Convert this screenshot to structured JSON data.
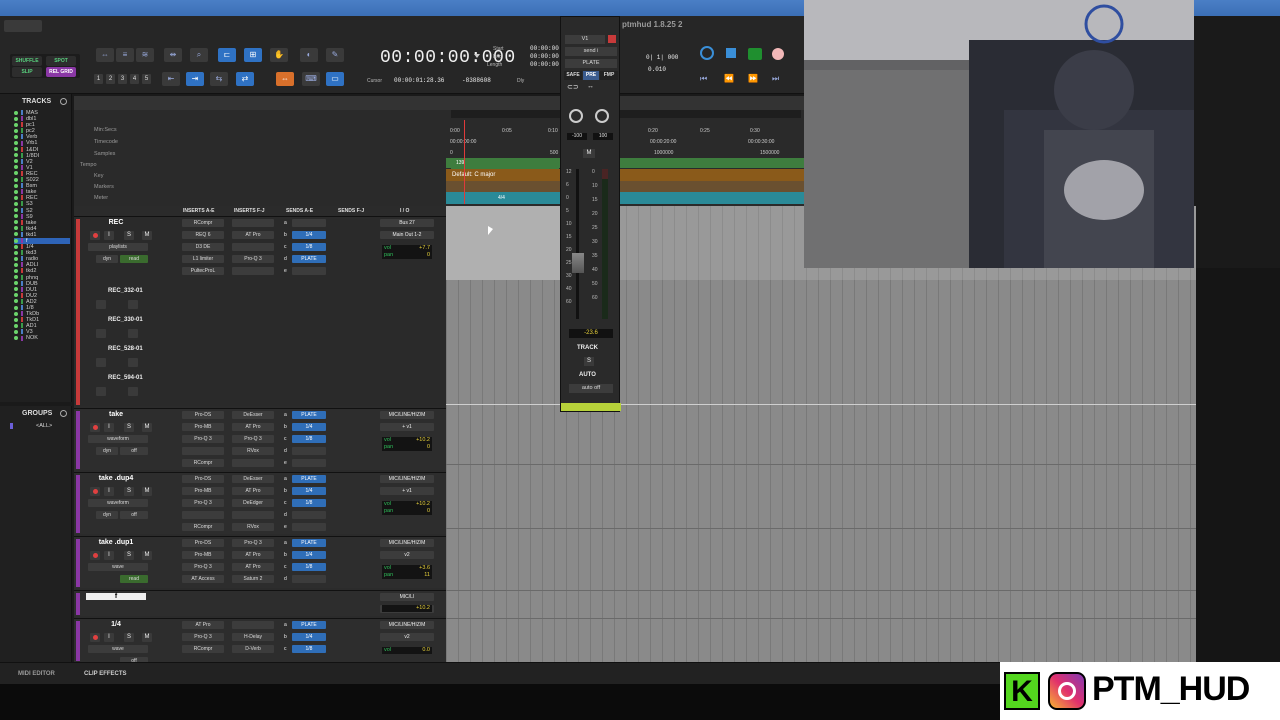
{
  "transport": {
    "modes": [
      "SHUFFLE",
      "SPOT",
      "SLIP",
      "REL GRID"
    ],
    "numbers": [
      "1",
      "2",
      "3",
      "4",
      "5"
    ],
    "main_counter": "00:00:00:000",
    "cursor_label": "Cursor",
    "cursor_value": "00:00:01:28.36",
    "cursor_sample": "-8388608",
    "dly_label": "Dly",
    "start_label": "Start",
    "end_label": "End",
    "length_label": "Length",
    "start_value": "00:00:00",
    "end_value": "00:00:00",
    "length_value": "00:00:00",
    "grid_value": "0| 1| 000",
    "nudge_value": "0.010"
  },
  "window_title": "ptmhud 1.8.25 2",
  "tracks_panel": {
    "title": "TRACKS",
    "items": [
      "MAS",
      "dbl1",
      "pc1",
      "pc2",
      "Verb",
      "Vrb1",
      "1&DI",
      "1/8DI",
      "V2",
      "V1",
      "REC",
      "S022",
      "Bsm",
      "take",
      "REC",
      "S3",
      "S2",
      "S9",
      "take",
      "tkd4",
      "tkd1",
      "f",
      "1/4",
      "tkd3",
      "radio",
      "ADLI",
      "tkd2",
      "phnq",
      "DUB",
      "DU1",
      "DU2",
      "AD2",
      "1/8",
      "TkDb",
      "TkD1",
      "AD1",
      "V3",
      "NOK"
    ]
  },
  "groups_panel": {
    "title": "GROUPS",
    "item": "<ALL>"
  },
  "rulers": {
    "names": [
      "Min:Secs",
      "Timecode",
      "Samples",
      "Tempo",
      "Key",
      "Markers",
      "Meter"
    ],
    "minsecs": [
      "0:00",
      "0:05",
      "0:10",
      "0:20",
      "0:25",
      "0:30"
    ],
    "timecode": [
      "00:00:00:00",
      "00:00:20:00",
      "00:00:30:00"
    ],
    "samples": [
      "0",
      "500",
      "1000000",
      "1500000"
    ],
    "tempo": "139",
    "key": "Default: C major",
    "meter": "4/4"
  },
  "columns": {
    "inserts_ae": "INSERTS A-E",
    "inserts_fj": "INSERTS F-J",
    "sends_ae": "SENDS A-E",
    "sends_fj": "SENDS F-J",
    "io": "I / O"
  },
  "tracks": [
    {
      "name": "REC",
      "playlist": "playlists",
      "view": "read",
      "dyn": "dyn",
      "inserts_ae": [
        "RCompr",
        "REQ 6",
        "D3 DE",
        "L1 limiter",
        "PultecProL"
      ],
      "inserts_fj": [
        "",
        "AT Pro",
        "",
        "Pro-Q 3",
        ""
      ],
      "sends": [
        "",
        "1/4",
        "1/8",
        "PLATE",
        ""
      ],
      "send_letters": [
        "a",
        "b",
        "c",
        "d",
        "e"
      ],
      "io_in": "Bus 27",
      "io_out": "Main Out 1-2",
      "vol_label": "vol",
      "vol": "+7.7",
      "pan_label": "pan",
      "pan": "0"
    },
    {
      "name": "take",
      "playlist": "waveform",
      "view": "off",
      "dyn": "dyn",
      "inserts_ae": [
        "Pro-DS",
        "Pro-MB",
        "Pro-Q 3",
        "",
        "RCompr"
      ],
      "inserts_fj": [
        "DeEsser",
        "AT Pro",
        "Pro-Q 3",
        "RVox",
        ""
      ],
      "sends": [
        "PLATE",
        "1/4",
        "1/8",
        "",
        ""
      ],
      "send_letters": [
        "a",
        "b",
        "c",
        "d",
        "e"
      ],
      "io_in": "MIC/LINE/HIZ/M",
      "io_out": "+ v1",
      "vol_label": "vol",
      "vol": "+10.2",
      "pan_label": "pan",
      "pan": "0"
    },
    {
      "name": "take .dup4",
      "playlist": "waveform",
      "view": "off",
      "dyn": "dyn",
      "inserts_ae": [
        "Pro-DS",
        "Pro-MB",
        "Pro-Q 3",
        "",
        "RCompr"
      ],
      "inserts_fj": [
        "DeEsser",
        "AT Pro",
        "DeEdger",
        "",
        "RVox"
      ],
      "sends": [
        "PLATE",
        "1/4",
        "1/8",
        "",
        ""
      ],
      "send_letters": [
        "a",
        "b",
        "c",
        "d",
        "e"
      ],
      "io_in": "MIC/LINE/HIZ/M",
      "io_out": "+ v1",
      "vol_label": "vol",
      "vol": "+10.2",
      "pan_label": "pan",
      "pan": "0"
    },
    {
      "name": "take .dup1",
      "playlist": "wave",
      "view": "read",
      "dyn": "",
      "inserts_ae": [
        "Pro-DS",
        "Pro-MB",
        "Pro-Q 3",
        "AT Access"
      ],
      "inserts_fj": [
        "Pro-Q 3",
        "AT Pro",
        "AT Pro",
        "Saturn 2"
      ],
      "sends": [
        "PLATE",
        "1/4",
        "1/8",
        ""
      ],
      "send_letters": [
        "a",
        "b",
        "c",
        "d"
      ],
      "io_in": "MIC/LINE/HIZ/M",
      "io_out": "v2",
      "vol_label": "vol",
      "vol": "+3.6",
      "pan_label": "pan",
      "pan": "11"
    },
    {
      "name": "f",
      "playlist": "wave",
      "view": "off",
      "dyn": "",
      "inserts_ae": [],
      "inserts_fj": [],
      "sends": [],
      "send_letters": [],
      "io_in": "MIC/LI",
      "io_out": "+ v1",
      "vol_label": "",
      "vol": "+10.2",
      "pan_label": "",
      "pan": ""
    },
    {
      "name": "1/4",
      "playlist": "wave",
      "view": "off",
      "dyn": "",
      "inserts_ae": [
        "AT Pro",
        "Pro-Q 3",
        "RCompr"
      ],
      "inserts_fj": [
        "",
        "H-Delay",
        "D-Verb"
      ],
      "sends": [
        "PLATE",
        "1/4",
        "1/8"
      ],
      "send_letters": [
        "a",
        "b",
        "c"
      ],
      "io_in": "MIC/LINE/HIZ/M",
      "io_out": "v2",
      "vol_label": "vol",
      "vol": "0.0",
      "pan_label": "",
      "pan": ""
    }
  ],
  "sub_playlists": [
    "REC_332-01",
    "REC_330-01",
    "REC_528-01",
    "REC_594-01"
  ],
  "strip": {
    "io_in": "V1",
    "io_out": "send i",
    "bus": "PLATE",
    "buttons": [
      "SAFE",
      "PRE",
      "FMP"
    ],
    "pan_left": "-100",
    "pan_right": "100",
    "mute": "M",
    "scale": [
      "12",
      "6",
      "0",
      "5",
      "10",
      "15",
      "20",
      "25",
      "30",
      "40",
      "60"
    ],
    "meter_scale": [
      "0",
      "10",
      "15",
      "20",
      "25",
      "30",
      "35",
      "40",
      "50",
      "60"
    ],
    "level": "-23.6",
    "track_label": "TRACK",
    "solo": "S",
    "auto_label": "AUTO",
    "auto_mode": "auto off"
  },
  "bottombar": {
    "midi_editor": "MIDI EDITOR",
    "clip_effects": "CLIP EFFECTS"
  },
  "logo": {
    "text": "PTM_HUD",
    "k_letter": "K"
  },
  "colors": {
    "accent": "#2f72c4",
    "send": "#2f6eb8",
    "tempo_ruler": "#3e7d3e",
    "key_ruler": "#8a5a1a",
    "meter_ruler": "#2a8a98",
    "rec_color": "#c73a3a"
  }
}
